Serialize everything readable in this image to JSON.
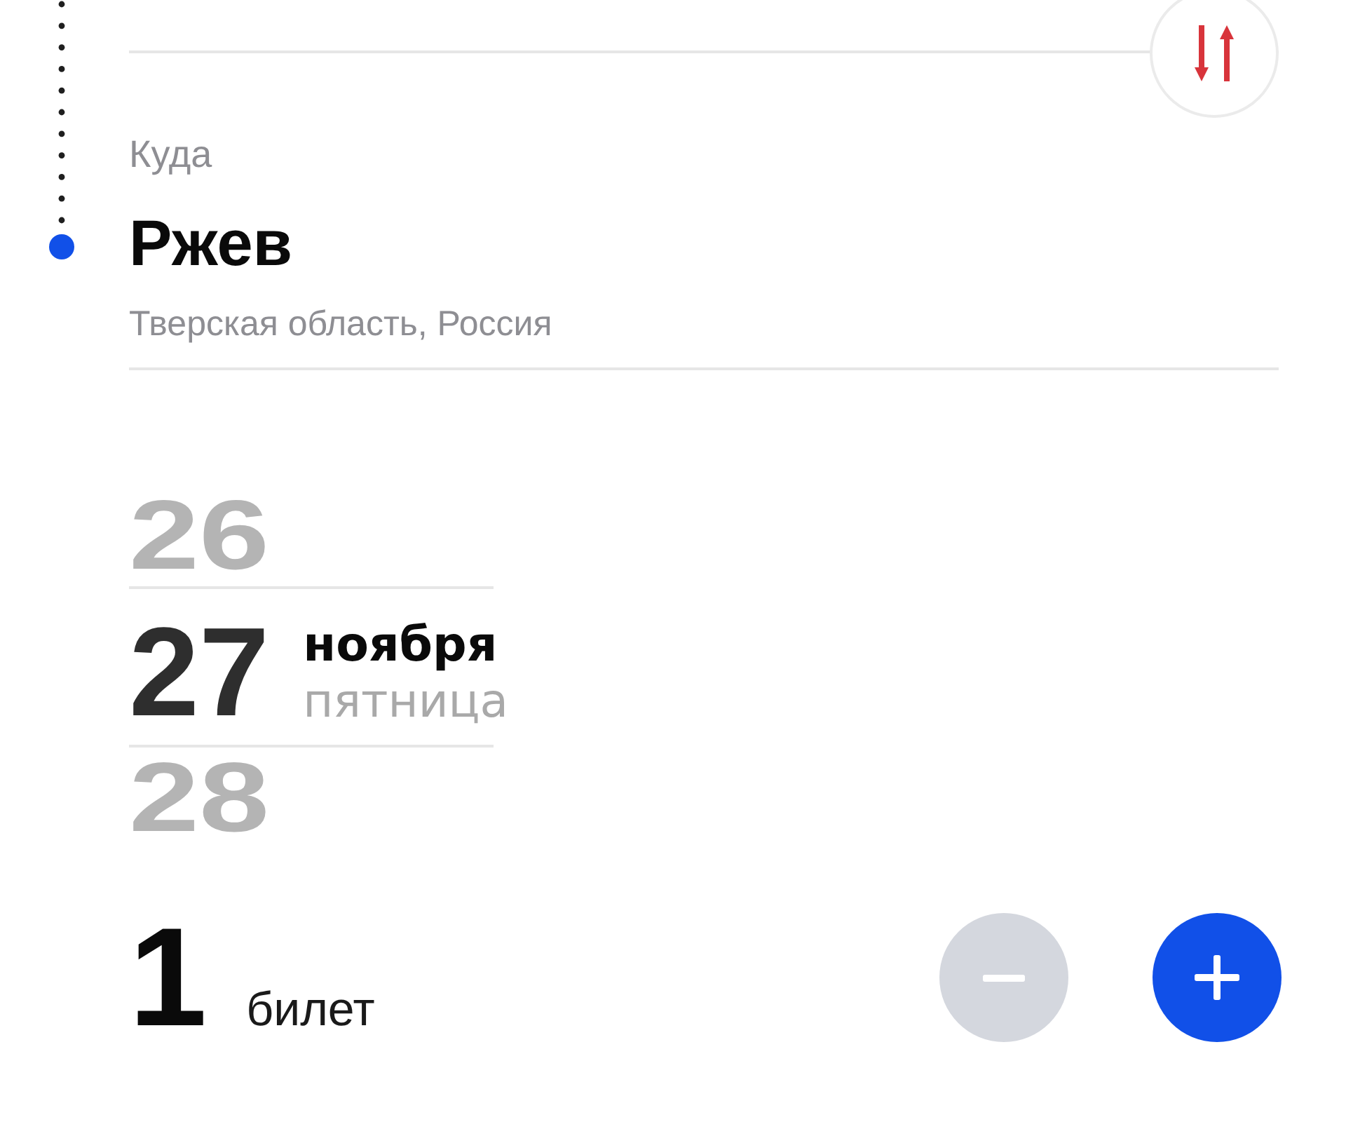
{
  "destination": {
    "label": "Куда",
    "city": "Ржев",
    "region": "Тверская область, Россия"
  },
  "date_picker": {
    "days": [
      {
        "day": "26",
        "selected": false
      },
      {
        "day": "27",
        "month": "ноября",
        "weekday": "пятница",
        "selected": true
      },
      {
        "day": "28",
        "selected": false
      }
    ]
  },
  "tickets": {
    "count": "1",
    "unit": "билет",
    "buttons": [
      {
        "kind": "minus",
        "disabled": true
      },
      {
        "kind": "plus",
        "disabled": false
      }
    ]
  }
}
